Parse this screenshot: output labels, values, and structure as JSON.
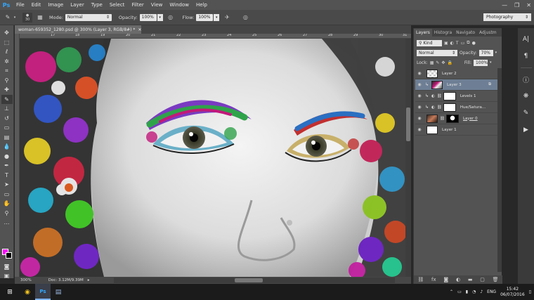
{
  "app": {
    "logo": "Ps"
  },
  "menu": [
    "File",
    "Edit",
    "Image",
    "Layer",
    "Type",
    "Select",
    "Filter",
    "View",
    "Window",
    "Help"
  ],
  "window_controls": {
    "minimize": "—",
    "maximize": "❐",
    "close": "✕"
  },
  "options": {
    "brush_size": "30",
    "mode_label": "Mode:",
    "mode_value": "Normal",
    "opacity_label": "Opacity:",
    "opacity_value": "100%",
    "flow_label": "Flow:",
    "flow_value": "100%"
  },
  "workspace": "Photography",
  "document": {
    "tab_title": "woman-659352_1280.psd @ 300% (Layer 3, RGB/8#) *",
    "zoom": "300%",
    "doc_info": "Doc: 3.12M/9.39M",
    "ruler_marks": [
      "17",
      "18",
      "19",
      "20",
      "21",
      "22",
      "23",
      "24",
      "25",
      "26",
      "27",
      "28",
      "29",
      "30",
      "31"
    ]
  },
  "layers_panel": {
    "tabs": [
      "Layers",
      "Histogra",
      "Navigato",
      "Adjustm"
    ],
    "filter_kind": "Kind",
    "blend_mode": "Normal",
    "opacity_label": "Opacity:",
    "opacity_value": "70%",
    "lock_label": "Lock:",
    "fill_label": "Fill:",
    "fill_value": "100%",
    "layers": [
      {
        "name": "Layer 2",
        "type": "transparent"
      },
      {
        "name": "Layer 3",
        "type": "photo-color",
        "selected": true
      },
      {
        "name": "Levels 1",
        "type": "adjustment"
      },
      {
        "name": "Hue/Satura...",
        "type": "adjustment"
      },
      {
        "name": "Layer 0",
        "type": "photo-mask"
      },
      {
        "name": "Layer 1",
        "type": "white"
      }
    ]
  },
  "taskbar": {
    "time": "15:42",
    "date": "06/07/2016",
    "lang": "ENG"
  },
  "colors": {
    "foreground": "#ff00ff",
    "background": "#000000",
    "accent": "#31a8ff"
  }
}
